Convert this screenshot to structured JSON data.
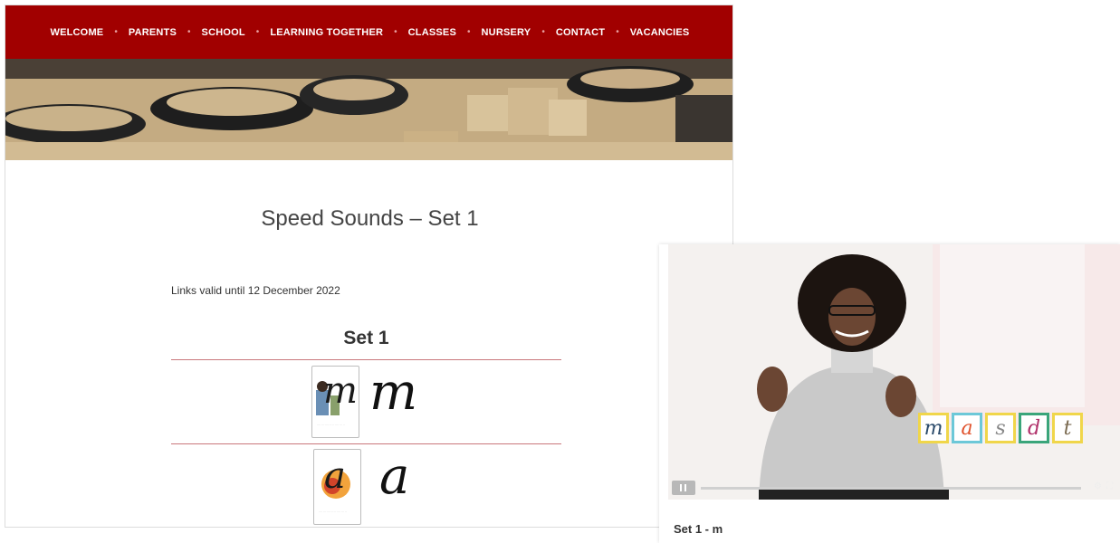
{
  "nav": {
    "items": [
      "WELCOME",
      "PARENTS",
      "SCHOOL",
      "LEARNING TOGETHER",
      "CLASSES",
      "NURSERY",
      "CONTACT",
      "VACANCIES"
    ],
    "separator": "•"
  },
  "page": {
    "title": "Speed Sounds – Set 1",
    "valid_text": "Links valid until 12 December 2022",
    "set_heading": "Set 1",
    "sounds": [
      {
        "letter": "m",
        "card_letter": "m"
      },
      {
        "letter": "a",
        "card_letter": "a"
      }
    ]
  },
  "video": {
    "title": "Set 1 - m",
    "tiles": [
      "m",
      "a",
      "s",
      "d",
      "t"
    ]
  },
  "colors": {
    "nav_bg": "#a10000",
    "divider": "#c9777c"
  }
}
